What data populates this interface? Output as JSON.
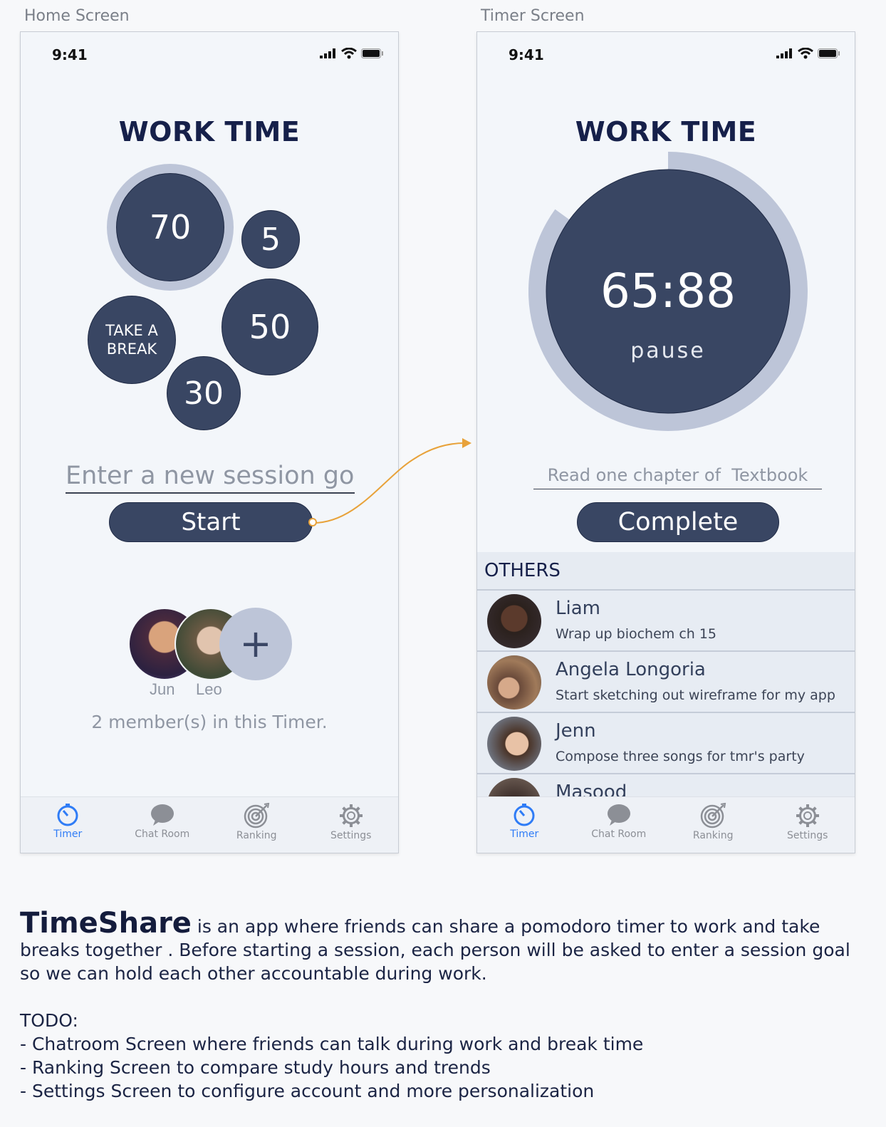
{
  "labels": {
    "home": "Home Screen",
    "timer": "Timer Screen"
  },
  "status": {
    "time": "9:41"
  },
  "home": {
    "title": "WORK TIME",
    "options": {
      "seventy": "70",
      "five": "5",
      "fifty": "50",
      "thirty": "30",
      "break_line1": "TAKE A",
      "break_line2": "BREAK"
    },
    "goal_placeholder": "Enter a new session goal",
    "start_label": "Start",
    "members": [
      {
        "name": "Jun"
      },
      {
        "name": "Leo"
      }
    ],
    "add_label": "+",
    "member_count": "2 member(s) in this Timer."
  },
  "timer": {
    "title": "WORK TIME",
    "time": "65:88",
    "pause_label": "pause",
    "progress_fraction": 0.85,
    "goal_value": "Read one chapter of  Textbook",
    "complete_label": "Complete",
    "others_header": "OTHERS",
    "others": [
      {
        "name": "Liam",
        "goal": "Wrap up biochem ch 15"
      },
      {
        "name": "Angela Longoria",
        "goal": "Start sketching out wireframe for my app"
      },
      {
        "name": "Jenn",
        "goal": "Compose three songs for tmr's party"
      },
      {
        "name": "Masood",
        "goal": ""
      }
    ]
  },
  "tabs": [
    {
      "label": "Timer",
      "icon": "timer-icon",
      "active": true
    },
    {
      "label": "Chat Room",
      "icon": "chat-bubble-icon",
      "active": false
    },
    {
      "label": "Ranking",
      "icon": "target-icon",
      "active": false
    },
    {
      "label": "Settings",
      "icon": "gear-icon",
      "active": false
    }
  ],
  "description": {
    "brand": "TimeShare",
    "text": " is an app where friends can share a pomodoro timer to work and take breaks together . Before starting a session, each person will be asked to enter a session goal so we can hold each other accountable during work.",
    "todo_title": "TODO:",
    "todo_items": [
      "- Chatroom Screen where friends can talk during work and break time",
      "- Ranking Screen to compare study hours and trends",
      "- Settings Screen to configure account and more personalization"
    ]
  },
  "colors": {
    "primary": "#394663",
    "ring": "#bdc5d8",
    "accent": "#2f7cf6",
    "arrow": "#e8a23a"
  }
}
